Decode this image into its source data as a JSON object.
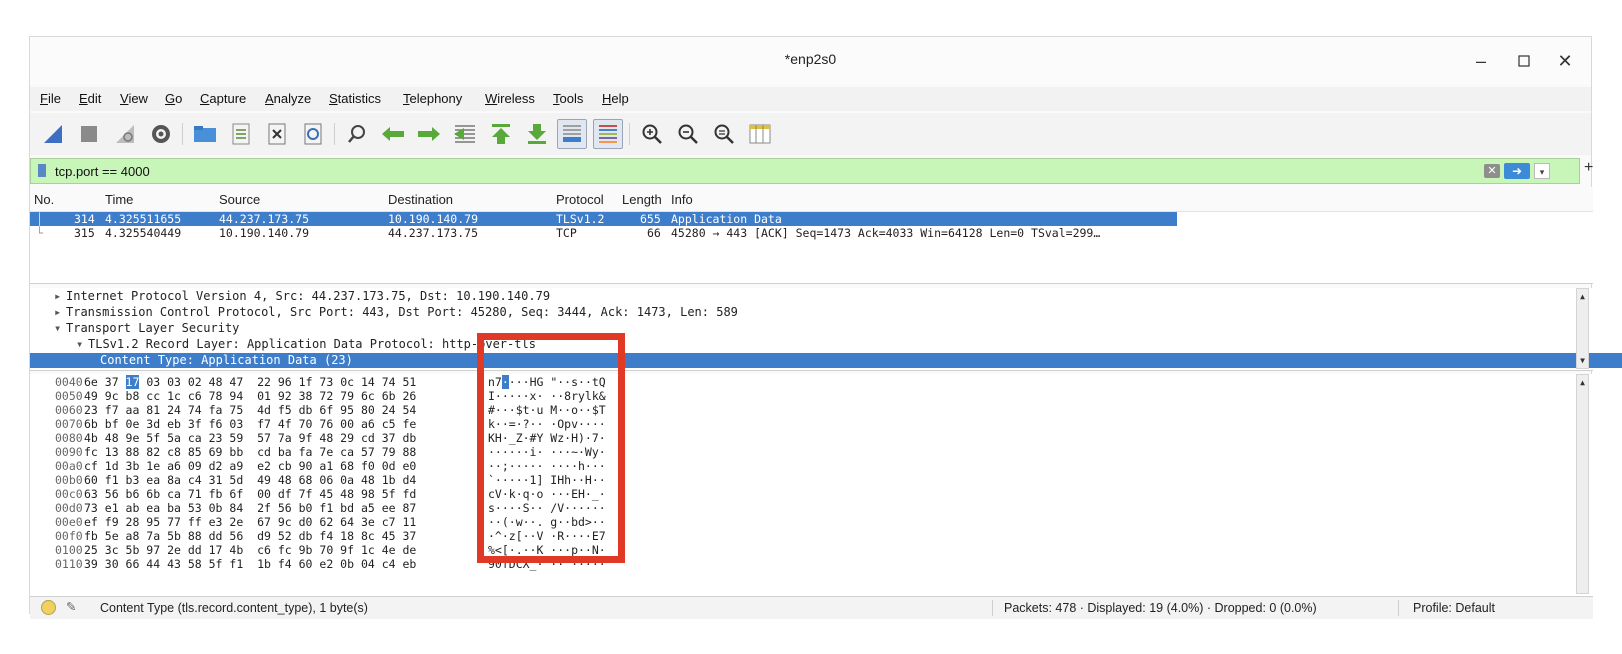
{
  "window": {
    "title": "*enp2s0"
  },
  "menu": [
    "File",
    "Edit",
    "View",
    "Go",
    "Capture",
    "Analyze",
    "Statistics",
    "Telephony",
    "Wireless",
    "Tools",
    "Help"
  ],
  "toolbar_icons": [
    "shark-fin-start-icon",
    "stop-icon",
    "restart-icon",
    "options-gear-icon",
    "open-folder-icon",
    "save-file-icon",
    "close-file-icon",
    "reload-icon",
    "find-icon",
    "back-arrow-icon",
    "forward-arrow-icon",
    "go-to-packet-icon",
    "first-packet-icon",
    "last-packet-icon",
    "autoscroll-icon",
    "colorize-icon",
    "zoom-in-icon",
    "zoom-out-icon",
    "zoom-normal-icon",
    "resize-columns-icon"
  ],
  "filter": {
    "value": "tcp.port == 4000"
  },
  "packet_list": {
    "columns": [
      "No.",
      "Time",
      "Source",
      "Destination",
      "Protocol",
      "Length",
      "Info"
    ],
    "rows": [
      {
        "no": "314",
        "time": "4.325511655",
        "source": "44.237.173.75",
        "destination": "10.190.140.79",
        "protocol": "TLSv1.2",
        "length": "655",
        "info": "Application Data"
      },
      {
        "no": "315",
        "time": "4.325540449",
        "source": "10.190.140.79",
        "destination": "44.237.173.75",
        "protocol": "TCP",
        "length": "66",
        "info": "45280 → 443 [ACK] Seq=1473 Ack=4033 Win=64128 Len=0 TSval=299…"
      }
    ]
  },
  "details": [
    {
      "arrow": "▸",
      "indent": 0,
      "text": "Internet Protocol Version 4, Src: 44.237.173.75, Dst: 10.190.140.79"
    },
    {
      "arrow": "▸",
      "indent": 0,
      "text": "Transmission Control Protocol, Src Port: 443, Dst Port: 45280, Seq: 3444, Ack: 1473, Len: 589"
    },
    {
      "arrow": "▾",
      "indent": 0,
      "text": "Transport Layer Security"
    },
    {
      "arrow": "▾",
      "indent": 2,
      "text": "TLSv1.2 Record Layer: Application Data Protocol: http-over-tls"
    },
    {
      "arrow": "",
      "indent": 6,
      "text": "Content Type: Application Data (23)"
    }
  ],
  "hex_rows": [
    {
      "offset": "0040",
      "bytes": "6e 37 17 03 03 02 48 47  22 96 1f 73 0c 14 74 51",
      "ascii": "n7····HG \"··s··tQ"
    },
    {
      "offset": "0050",
      "bytes": "49 9c b8 cc 1c c6 78 94  01 92 38 72 79 6c 6b 26",
      "ascii": "I·····x· ··8rylk&"
    },
    {
      "offset": "0060",
      "bytes": "23 f7 aa 81 24 74 fa 75  4d f5 db 6f 95 80 24 54",
      "ascii": "#···$t·u M··o··$T"
    },
    {
      "offset": "0070",
      "bytes": "6b bf 0e 3d eb 3f f6 03  f7 4f 70 76 00 a6 c5 fe",
      "ascii": "k··=·?·· ·Opv····"
    },
    {
      "offset": "0080",
      "bytes": "4b 48 9e 5f 5a ca 23 59  57 7a 9f 48 29 cd 37 db",
      "ascii": "KH·_Z·#Y Wz·H)·7·"
    },
    {
      "offset": "0090",
      "bytes": "fc 13 88 82 c8 85 69 bb  cd ba fa 7e ca 57 79 88",
      "ascii": "······i· ···~·Wy·"
    },
    {
      "offset": "00a0",
      "bytes": "cf 1d 3b 1e a6 09 d2 a9  e2 cb 90 a1 68 f0 0d e0",
      "ascii": "··;····· ····h···"
    },
    {
      "offset": "00b0",
      "bytes": "60 f1 b3 ea 8a c4 31 5d  49 48 68 06 0a 48 1b d4",
      "ascii": "`·····1] IHh··H··"
    },
    {
      "offset": "00c0",
      "bytes": "63 56 b6 6b ca 71 fb 6f  00 df 7f 45 48 98 5f fd",
      "ascii": "cV·k·q·o ···EH·_·"
    },
    {
      "offset": "00d0",
      "bytes": "73 e1 ab ea ba 53 0b 84  2f 56 b0 f1 bd a5 ee 87",
      "ascii": "s····S·· /V······"
    },
    {
      "offset": "00e0",
      "bytes": "ef f9 28 95 77 ff e3 2e  67 9c d0 62 64 3e c7 11",
      "ascii": "··(·w··. g··bd>··"
    },
    {
      "offset": "00f0",
      "bytes": "fb 5e a8 7a 5b 88 dd 56  d9 52 db f4 18 8c 45 37",
      "ascii": "·^·z[··V ·R····E7"
    },
    {
      "offset": "0100",
      "bytes": "25 3c 5b 97 2e dd 17 4b  c6 fc 9b 70 9f 1c 4e de",
      "ascii": "%<[·.··K ···p··N·"
    },
    {
      "offset": "0110",
      "bytes": "39 30 66 44 43 58 5f f1  1b f4 60 e2 0b 04 c4 eb",
      "ascii": "90fDCX_· ··`·····"
    }
  ],
  "status": {
    "field": "Content Type (tls.record.content_type), 1 byte(s)",
    "packets": "Packets: 478 · Displayed: 19 (4.0%) · Dropped: 0 (0.0%)",
    "profile": "Profile: Default"
  },
  "colors": {
    "selection": "#3d7dca",
    "filter_bg": "#c8f5b8",
    "highlight_box": "#e03a26"
  }
}
